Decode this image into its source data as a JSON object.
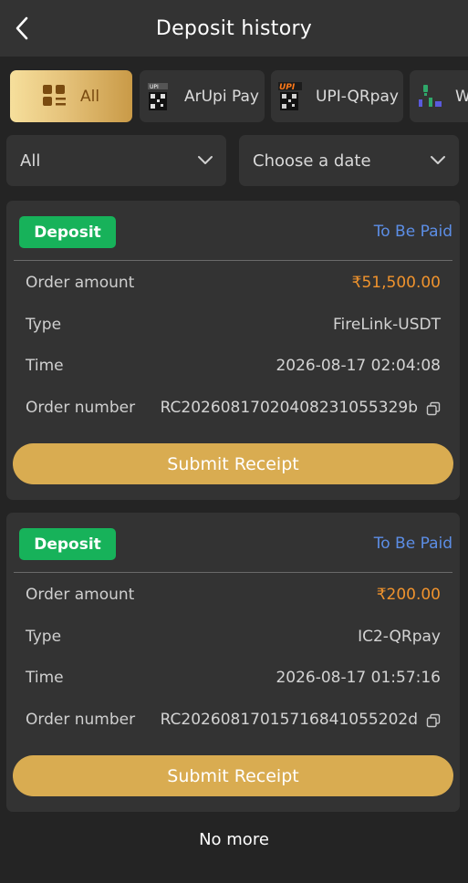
{
  "header": {
    "title": "Deposit history",
    "back_icon": "chevron-left-icon"
  },
  "tabs": [
    {
      "label": "All",
      "icon": "grid-list-icon",
      "active": true
    },
    {
      "label": "ArUpi Pay",
      "icon": "upi-qr-icon",
      "active": false
    },
    {
      "label": "UPI-QRpay",
      "icon": "upi-qr-icon",
      "active": false
    },
    {
      "label": "W",
      "icon": "usdt-coin-icon",
      "active": false
    }
  ],
  "filters": {
    "type": {
      "value": "All"
    },
    "date": {
      "value": "Choose a date"
    }
  },
  "labels": {
    "order_amount": "Order amount",
    "type": "Type",
    "time": "Time",
    "order_number": "Order number",
    "submit": "Submit Receipt"
  },
  "records": [
    {
      "badge": "Deposit",
      "status": "To Be Paid",
      "amount": "₹51,500.00",
      "type": "FireLink-USDT",
      "time": "2026-08-17 02:04:08",
      "order_number": "RC2026081702040823105532​9b"
    },
    {
      "badge": "Deposit",
      "status": "To Be Paid",
      "amount": "₹200.00",
      "type": "IC2-QRpay",
      "time": "2026-08-17 01:57:16",
      "order_number": "RC202608170157168410552​02d"
    }
  ],
  "footer": {
    "text": "No more"
  },
  "colors": {
    "background": "#242424",
    "surface": "#333333",
    "accent_gold": "#d9ac51",
    "badge_green": "#17b25a",
    "status_blue": "#5c8ee6",
    "amount_orange": "#f0932d"
  }
}
